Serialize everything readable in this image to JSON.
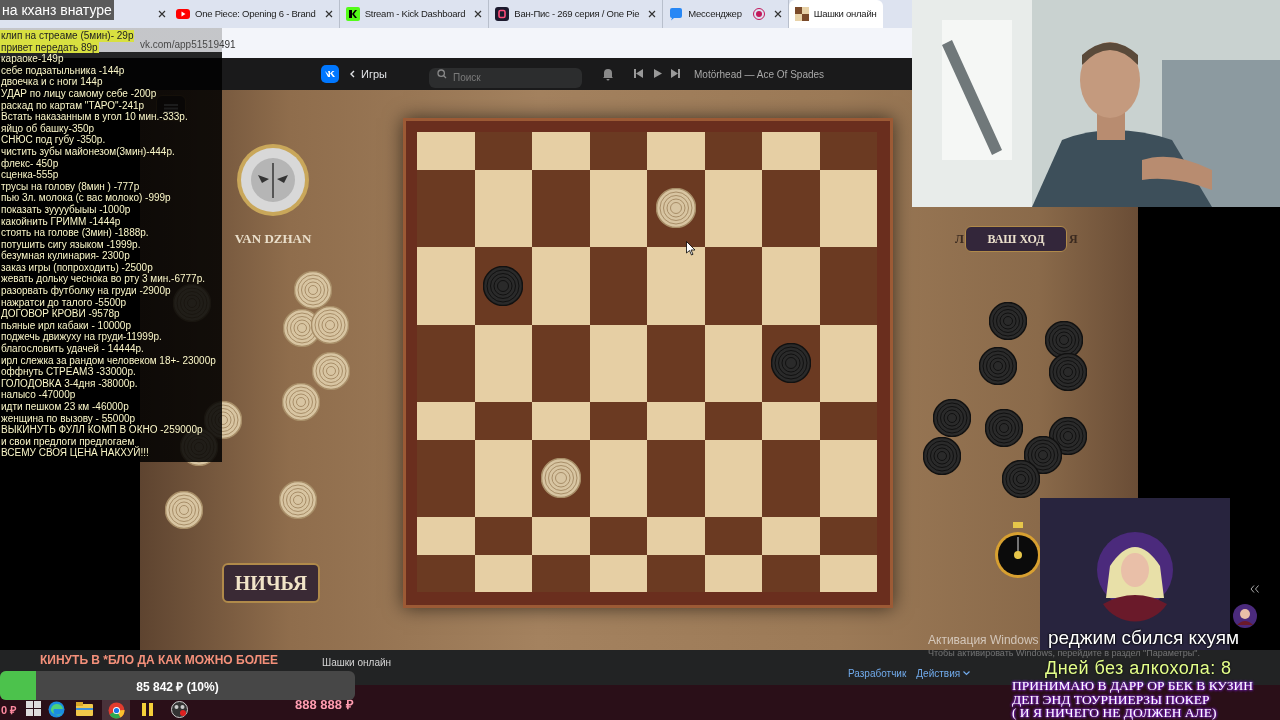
{
  "overlay_title": "на кханз внатуре",
  "price_list": [
    {
      "text": "клип на стреаме (5мин)- 29р",
      "highlighted": true
    },
    {
      "text": "привет передать 89р",
      "highlighted": true
    },
    {
      "text": "караоке-149р",
      "highlighted": false
    },
    {
      "text": "себе подзатыльника -144р",
      "highlighted": false
    },
    {
      "text": "двоечка и с ноги 144р",
      "highlighted": false
    },
    {
      "text": "УДАР по лицу самому себе -200р",
      "highlighted": false
    },
    {
      "text": "раскад по картам \"ТАРО\"-241р",
      "highlighted": false
    },
    {
      "text": "Встать наказанным в угол 10 мин.-333р.",
      "highlighted": false
    },
    {
      "text": "яйцо об башку-350р",
      "highlighted": false
    },
    {
      "text": "СНЮС под губу -350р.",
      "highlighted": false
    },
    {
      "text": "чистить зубы майонезом(3мин)-444р.",
      "highlighted": false
    },
    {
      "text": "флекс- 450р",
      "highlighted": false
    },
    {
      "text": "сценка-555р",
      "highlighted": false
    },
    {
      "text": "трусы на голову (8мин ) -777р",
      "highlighted": false
    },
    {
      "text": "пью 3л. молока (с вас молоко) -999р",
      "highlighted": false
    },
    {
      "text": "показать зуууубыыы -1000р",
      "highlighted": false
    },
    {
      "text": "какойнить ГРИММ -1444р",
      "highlighted": false
    },
    {
      "text": "стоять на голове (3мин) -1888р.",
      "highlighted": false
    },
    {
      "text": "потушить сигу языком -1999р.",
      "highlighted": false
    },
    {
      "text": "безумная кулинария- 2300р",
      "highlighted": false
    },
    {
      "text": "заказ игры (попроходить) -2500р",
      "highlighted": false
    },
    {
      "text": "жевать дольку чеснока во рту 3 мин.-6777р.",
      "highlighted": false
    },
    {
      "text": "разорвать футболку на груди -2900р",
      "highlighted": false
    },
    {
      "text": "нажратси до талого -5500р",
      "highlighted": false
    },
    {
      "text": "ДОГОВОР КРОВИ -9578р",
      "highlighted": false
    },
    {
      "text": "пьяные ирл кабаки - 10000р",
      "highlighted": false
    },
    {
      "text": "поджечь движуху на груди-11999р.",
      "highlighted": false
    },
    {
      "text": "благословить удачей - 14444р.",
      "highlighted": false
    },
    {
      "text": "ирл слежка за рандом человеком 18+- 23000р",
      "highlighted": false
    },
    {
      "text": "оффнуть СТРЕАМЗ -33000р.",
      "highlighted": false
    },
    {
      "text": "ГОЛОДОВКА 3-4дня -38000р.",
      "highlighted": false
    },
    {
      "text": "налысо -47000р",
      "highlighted": false
    },
    {
      "text": "идти пешком 23 км -46000р",
      "highlighted": false
    },
    {
      "text": "женщина по вызову - 55000р",
      "highlighted": false
    },
    {
      "text": "ВЫКИНУТЬ ФУЛЛ КОМП В ОКНО -259000р",
      "highlighted": false
    },
    {
      "text": "и свои предлоги предлогаем",
      "highlighted": false
    },
    {
      "text": "ВСЕМУ СВОЯ ЦЕНА НАКХУЙ!!!",
      "highlighted": false
    }
  ],
  "browser": {
    "tabs": [
      {
        "kind": "covered",
        "selected": false,
        "recording": false
      },
      {
        "kind": "youtube",
        "title": "One Piece: Opening 6 - Brand",
        "selected": false,
        "recording": false
      },
      {
        "kind": "kick",
        "title": "Stream - Kick Dashboard",
        "selected": false,
        "recording": false
      },
      {
        "kind": "rezka",
        "title": "Ван-Пис - 269 серия / One Pie",
        "selected": false,
        "recording": false
      },
      {
        "kind": "messenger",
        "title": "Мессенджер",
        "selected": false,
        "recording": true
      },
      {
        "kind": "game",
        "title": "Шашки онлайн",
        "selected": true,
        "recording": false
      }
    ],
    "address": "vk.com/app51519491"
  },
  "vk_header": {
    "back_label": "Игры",
    "search_placeholder": "Поиск",
    "track": "Motörhead — Ace Of Spades"
  },
  "game": {
    "player_name": "VAN DZHAN",
    "draw_button": "НИЧЬЯ",
    "turn_label": "ВАШ ХОД",
    "turn_hint_left": "Л",
    "turn_hint_right": "Я",
    "board": [
      [
        {
          "kind": "empty"
        },
        {
          "kind": "empty"
        },
        {
          "kind": "empty"
        },
        {
          "kind": "empty"
        },
        {
          "kind": "empty"
        },
        {
          "kind": "empty"
        },
        {
          "kind": "empty"
        },
        {
          "kind": "empty"
        }
      ],
      [
        {
          "kind": "empty"
        },
        {
          "kind": "empty"
        },
        {
          "kind": "empty"
        },
        {
          "kind": "empty"
        },
        {
          "kind": "light"
        },
        {
          "kind": "empty"
        },
        {
          "kind": "empty"
        },
        {
          "kind": "empty"
        }
      ],
      [
        {
          "kind": "empty"
        },
        {
          "kind": "dark"
        },
        {
          "kind": "empty"
        },
        {
          "kind": "empty"
        },
        {
          "kind": "empty"
        },
        {
          "kind": "empty"
        },
        {
          "kind": "empty"
        },
        {
          "kind": "empty"
        }
      ],
      [
        {
          "kind": "empty"
        },
        {
          "kind": "empty"
        },
        {
          "kind": "empty"
        },
        {
          "kind": "empty"
        },
        {
          "kind": "empty"
        },
        {
          "kind": "empty"
        },
        {
          "kind": "dark"
        },
        {
          "kind": "empty"
        }
      ],
      [
        {
          "kind": "empty"
        },
        {
          "kind": "empty"
        },
        {
          "kind": "empty"
        },
        {
          "kind": "empty"
        },
        {
          "kind": "empty"
        },
        {
          "kind": "empty"
        },
        {
          "kind": "empty"
        },
        {
          "kind": "empty"
        }
      ],
      [
        {
          "kind": "empty"
        },
        {
          "kind": "empty"
        },
        {
          "kind": "light"
        },
        {
          "kind": "empty"
        },
        {
          "kind": "empty"
        },
        {
          "kind": "empty"
        },
        {
          "kind": "empty"
        },
        {
          "kind": "empty"
        }
      ],
      [
        {
          "kind": "empty"
        },
        {
          "kind": "empty"
        },
        {
          "kind": "empty"
        },
        {
          "kind": "empty"
        },
        {
          "kind": "empty"
        },
        {
          "kind": "empty"
        },
        {
          "kind": "empty"
        },
        {
          "kind": "empty"
        }
      ],
      [
        {
          "kind": "empty"
        },
        {
          "kind": "empty"
        },
        {
          "kind": "empty"
        },
        {
          "kind": "empty"
        },
        {
          "kind": "empty"
        },
        {
          "kind": "empty"
        },
        {
          "kind": "empty"
        },
        {
          "kind": "empty"
        }
      ]
    ]
  },
  "footer": {
    "app_title": "Шашки онлайн",
    "links": [
      {
        "label": "Разработчик",
        "dropdown": false
      },
      {
        "label": "Действия",
        "dropdown": true
      }
    ]
  },
  "windows_notice": {
    "title": "Активация Windows",
    "text": "Чтобы активировать Windows, перейдите в раздел \"Параметры\"."
  },
  "donation": {
    "caption": "КИНУТЬ В *БЛО ДА КАК МОЖНО БОЛЕЕ",
    "reading": "85 842 ₽ (10%)",
    "level": 0.1
  },
  "taskbar": {
    "start_amount": "0 ₽",
    "goal": "888 888 ₽"
  },
  "stream_overlays": {
    "status": "реджим сбился кхуям",
    "counter": "Дней без алкохола: 8",
    "rules": [
      "ПРИНИМАЮ В ДАРР ОР БЕК В КУЗИН",
      "ДЕП ЭНД ТОУРНИЕРЗЫ ПОКЕР",
      "( И Я НИЧЕГО НЕ ДОЛЖЕН АЛЕ)"
    ]
  }
}
